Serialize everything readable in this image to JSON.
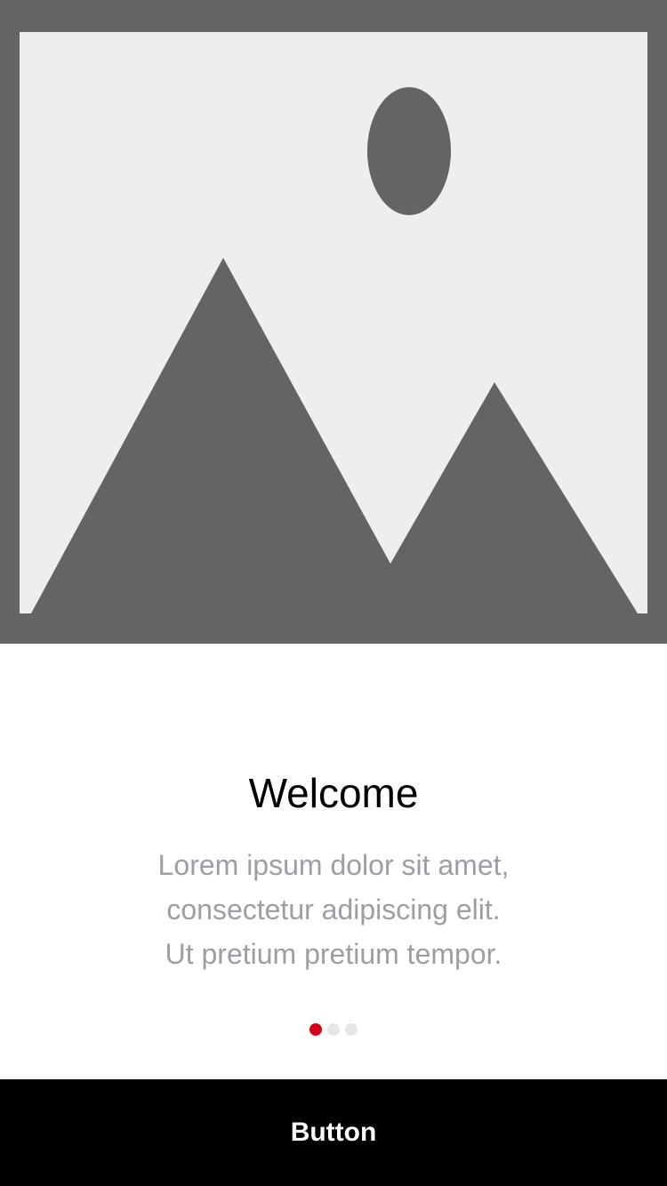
{
  "hero": {
    "image_icon": "image-placeholder-icon",
    "colors": {
      "frame": "#646464",
      "canvas": "#eeeeee",
      "shapes": "#646464"
    }
  },
  "onboarding": {
    "title": "Welcome",
    "description_lines": [
      "Lorem ipsum dolor sit amet,",
      "consectetur adipiscing elit.",
      "Ut pretium pretium tempor."
    ],
    "page_count": 3,
    "active_page": 1,
    "colors": {
      "active_dot": "#d0021b",
      "inactive_dot": "#e6e6e6",
      "description": "#9b9fa5"
    }
  },
  "footer": {
    "button_label": "Button",
    "button_background": "#000000",
    "button_text_color": "#ffffff"
  }
}
